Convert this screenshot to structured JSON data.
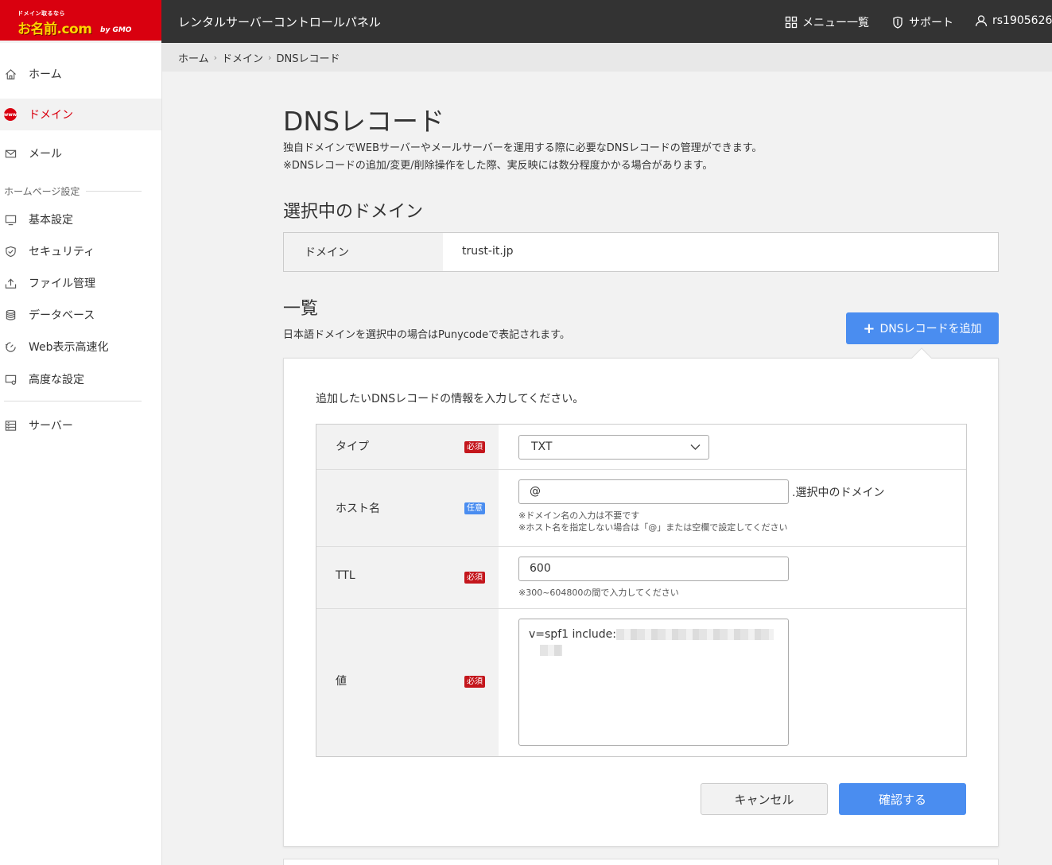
{
  "header": {
    "logo_tag": "ドメイン取るなら",
    "logo_main": "お名前.com",
    "logo_gmo": "by GMO",
    "app_title": "レンタルサーバーコントロールパネル",
    "menu_label": "メニュー一覧",
    "support_label": "サポート",
    "user_label": "rs1905626"
  },
  "sidebar": {
    "home": "ホーム",
    "domain": "ドメイン",
    "mail": "メール",
    "section_homepage": "ホームページ設定",
    "basic": "基本設定",
    "security": "セキュリティ",
    "file": "ファイル管理",
    "database": "データベース",
    "web_speed": "Web表示高速化",
    "advanced": "高度な設定",
    "server": "サーバー",
    "www_badge": "www"
  },
  "breadcrumb": [
    "ホーム",
    "ドメイン",
    "DNSレコード"
  ],
  "main": {
    "title": "DNSレコード",
    "desc_line1": "独自ドメインでWEBサーバーやメールサーバーを運用する際に必要なDNSレコードの管理ができます。",
    "desc_line2": "※DNSレコードの追加/変更/削除操作をした際、実反映には数分程度かかる場合があります。",
    "selected_heading": "選択中のドメイン",
    "domain_key": "ドメイン",
    "domain_value": "trust-it.jp",
    "list_heading": "一覧",
    "list_note": "日本語ドメインを選択中の場合はPunycodeで表記されます。",
    "add_button": "DNSレコードを追加"
  },
  "form": {
    "intro": "追加したいDNSレコードの情報を入力してください。",
    "required": "必須",
    "optional": "任意",
    "type_label": "タイプ",
    "type_value": "TXT",
    "host_label": "ホスト名",
    "host_value": "@",
    "host_suffix": ".選択中のドメイン",
    "host_hint1": "※ドメイン名の入力は不要です",
    "host_hint2": "※ホスト名を指定しない場合は「@」または空欄で設定してください",
    "ttl_label": "TTL",
    "ttl_value": "600",
    "ttl_hint": "※300~604800の間で入力してください",
    "value_label": "値",
    "value_text": "v=spf1 include:",
    "cancel": "キャンセル",
    "confirm": "確認する"
  },
  "colors": {
    "brand_red": "#d9000f",
    "accent_blue": "#4a8df0",
    "header_dark": "#333333"
  }
}
